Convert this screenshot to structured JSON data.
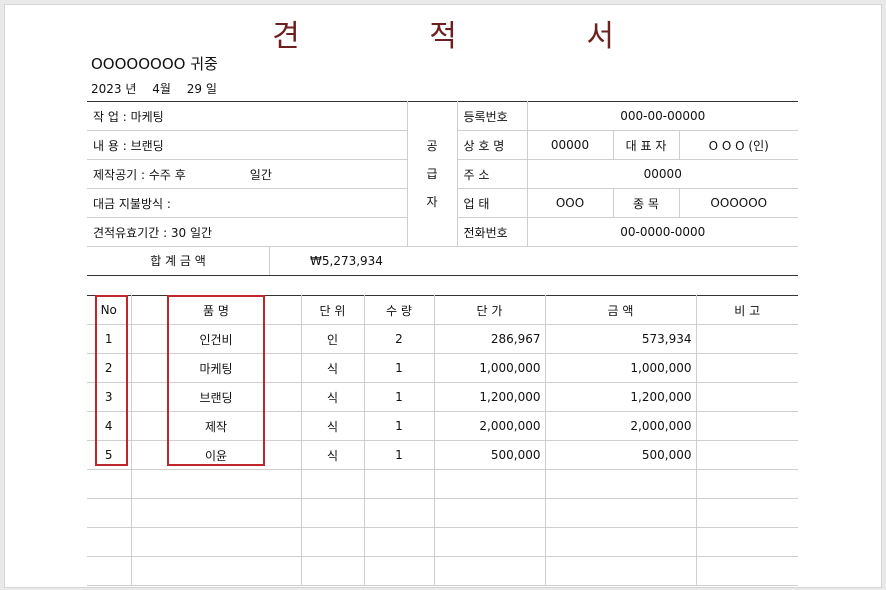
{
  "title": "견 적 서",
  "recipient": "OOOOOOOO 귀중",
  "date": {
    "year": "2023 년",
    "month": "4월",
    "day": "29 일"
  },
  "info_left": [
    {
      "label": "작    업",
      "value": "마케팅"
    },
    {
      "label": "내    용",
      "value": "브랜딩"
    },
    {
      "label": "제작공기",
      "value": "수주 후",
      "extra": "일간"
    },
    {
      "label": "대금 지불방식",
      "value": ""
    },
    {
      "label": "견적유효기간",
      "value": "30 일간"
    }
  ],
  "supplier_vertical": [
    "공",
    "급",
    "자"
  ],
  "supplier": {
    "reg_label": "등록번호",
    "reg_value": "000-00-00000",
    "name_label": "상 호 명",
    "name_value": "00000",
    "rep_label": "대 표 자",
    "rep_value": "O O O  (인)",
    "addr_label": "주    소",
    "addr_value": "00000",
    "biz_label": "업    태",
    "biz_value": "OOO",
    "item_label": "종    목",
    "item_value": "OOOOOO",
    "phone_label": "전화번호",
    "phone_value": "00-0000-0000"
  },
  "total": {
    "label": "합 계 금 액",
    "value": "₩5,273,934"
  },
  "items_header": [
    "No",
    "품    명",
    "단 위",
    "수  량",
    "단    가",
    "금          액",
    "비    고"
  ],
  "items": [
    {
      "no": "1",
      "name": "인건비",
      "unit": "인",
      "qty": "2",
      "price": "286,967",
      "amount": "573,934",
      "note": ""
    },
    {
      "no": "2",
      "name": "마케팅",
      "unit": "식",
      "qty": "1",
      "price": "1,000,000",
      "amount": "1,000,000",
      "note": ""
    },
    {
      "no": "3",
      "name": "브랜딩",
      "unit": "식",
      "qty": "1",
      "price": "1,200,000",
      "amount": "1,200,000",
      "note": ""
    },
    {
      "no": "4",
      "name": "제작",
      "unit": "식",
      "qty": "1",
      "price": "2,000,000",
      "amount": "2,000,000",
      "note": ""
    },
    {
      "no": "5",
      "name": "이윤",
      "unit": "식",
      "qty": "1",
      "price": "500,000",
      "amount": "500,000",
      "note": ""
    }
  ],
  "highlight_color": "#c0272d",
  "title_color": "#6e1f1f"
}
